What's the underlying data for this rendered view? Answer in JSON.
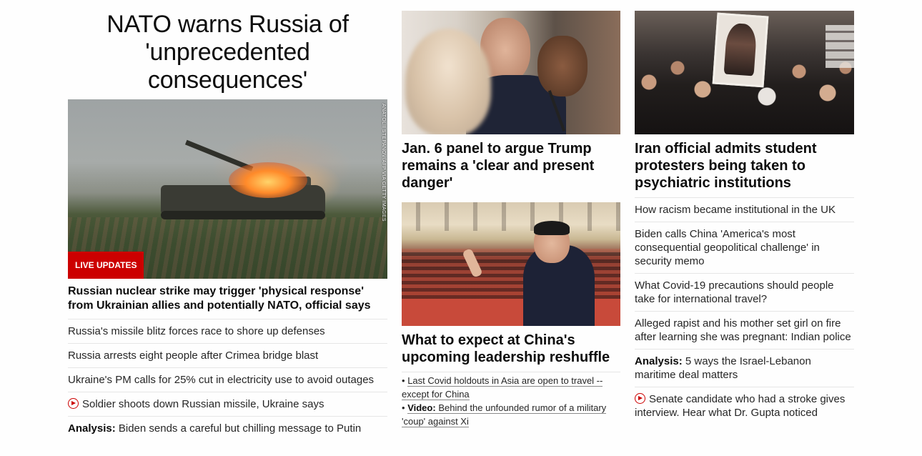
{
  "col1": {
    "main_headline": "NATO warns Russia of 'unprecedented consequences'",
    "hero_image_alt": "Russian artillery firing",
    "hero_credit": "ANATOLII STEPANOV/AFP VIA GETTY IMAGES",
    "badge": "LIVE UPDATES",
    "lead_headline": "Russian nuclear strike may trigger 'physical response' from Ukrainian allies and potentially NATO, official says",
    "items": [
      {
        "text": "Russia's missile blitz forces race to shore up defenses"
      },
      {
        "text": "Russia arrests eight people after Crimea bridge blast"
      },
      {
        "text": "Ukraine's PM calls for 25% cut in electricity use to avoid outages"
      },
      {
        "text": "Soldier shoots down Russian missile, Ukraine says",
        "icon": "play-icon"
      },
      {
        "kicker": "Analysis:",
        "text": "Biden sends a careful but chilling message to Putin"
      }
    ]
  },
  "col2": {
    "jan6_headline": "Jan. 6 panel to argue Trump remains a 'clear and present danger'",
    "china_headline": "What to expect at China's upcoming leadership reshuffle",
    "bullets": [
      {
        "prefix": "•",
        "text": "Last Covid holdouts in Asia are open to travel -- except for China"
      },
      {
        "prefix": "•",
        "kicker": "Video:",
        "text": "Behind the unfounded rumor of a military 'coup' against Xi"
      }
    ]
  },
  "col3": {
    "iran_headline": "Iran official admits student protesters being taken to psychiatric institutions",
    "items": [
      {
        "text": "How racism became institutional in the UK"
      },
      {
        "text": "Biden calls China 'America's most consequential geopolitical challenge' in security memo"
      },
      {
        "text": "What Covid-19 precautions should people take for international travel?"
      },
      {
        "text": "Alleged rapist and his mother set girl on fire after learning she was pregnant: Indian police"
      },
      {
        "kicker": "Analysis:",
        "text": "5 ways the Israel-Lebanon maritime deal matters"
      },
      {
        "text": "Senate candidate who had a stroke gives interview. Hear what Dr. Gupta noticed",
        "icon": "play-icon"
      }
    ]
  },
  "colors": {
    "accent": "#cc0000",
    "text": "#0c0c0c",
    "divider": "#e6e6e6"
  }
}
